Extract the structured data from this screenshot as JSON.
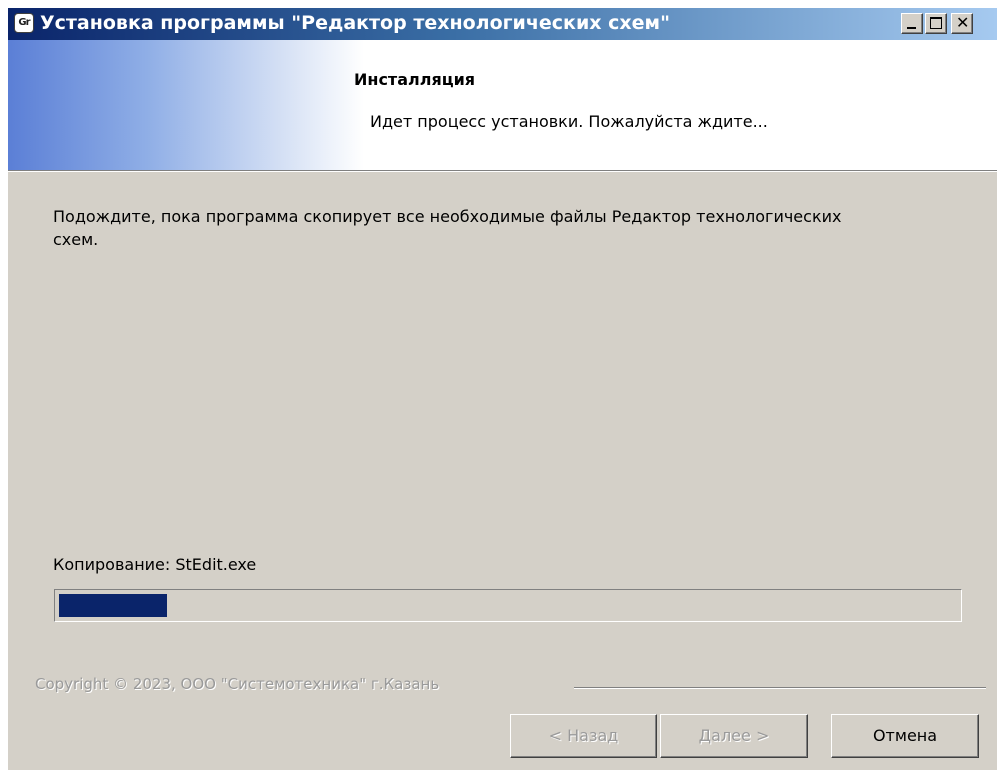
{
  "window": {
    "icon_text": "Gr",
    "title": "Установка программы \"Редактор технологических схем\""
  },
  "header": {
    "title": "Инсталляция",
    "subtitle": "Идет процесс установки. Пожалуйста ждите..."
  },
  "main": {
    "description": "Подождите, пока программа скопирует все необходимые файлы Редактор технологических схем.",
    "status": "Копирование: StEdit.exe",
    "progress_fraction": 0.12
  },
  "footer": {
    "copyright": "Copyright © 2023, ООО \"Системотехника\" г.Казань",
    "back_label": "< Назад",
    "next_label": "Далее >",
    "cancel_label": "Отмена"
  },
  "colors": {
    "progress_fill": "#0a246a",
    "titlebar_start": "#0a246a",
    "titlebar_end": "#a6caf0",
    "dialog_background": "#d4d0c8"
  }
}
